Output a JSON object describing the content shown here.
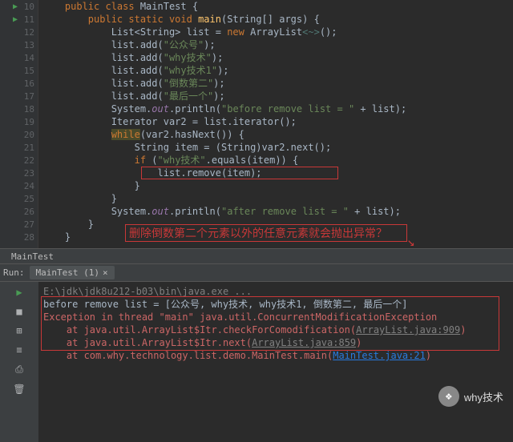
{
  "lines": [
    {
      "n": 10,
      "run": true,
      "code": [
        {
          "c": "kw",
          "t": "    public class "
        },
        {
          "c": "cls",
          "t": "MainTest {"
        }
      ]
    },
    {
      "n": 11,
      "run": true,
      "code": [
        {
          "c": "kw",
          "t": "        public static void "
        },
        {
          "c": "mth",
          "t": "main"
        },
        {
          "c": "cls",
          "t": "(String[] args) {"
        }
      ]
    },
    {
      "n": 12,
      "code": [
        {
          "c": "cls",
          "t": "            List<String> list = "
        },
        {
          "c": "kw",
          "t": "new "
        },
        {
          "c": "cls",
          "t": "ArrayList"
        },
        {
          "c": "gen",
          "t": "<~>"
        },
        {
          "c": "cls",
          "t": "();"
        }
      ]
    },
    {
      "n": 13,
      "code": [
        {
          "c": "cls",
          "t": "            list.add("
        },
        {
          "c": "str",
          "t": "\"公众号\""
        },
        {
          "c": "cls",
          "t": ");"
        }
      ]
    },
    {
      "n": 14,
      "code": [
        {
          "c": "cls",
          "t": "            list.add("
        },
        {
          "c": "str",
          "t": "\"why技术\""
        },
        {
          "c": "cls",
          "t": ");"
        }
      ]
    },
    {
      "n": 15,
      "code": [
        {
          "c": "cls",
          "t": "            list.add("
        },
        {
          "c": "str",
          "t": "\"why技术1\""
        },
        {
          "c": "cls",
          "t": ");"
        }
      ]
    },
    {
      "n": 16,
      "code": [
        {
          "c": "cls",
          "t": "            list.add("
        },
        {
          "c": "str",
          "t": "\"倒数第二\""
        },
        {
          "c": "cls",
          "t": ");"
        }
      ]
    },
    {
      "n": 17,
      "code": [
        {
          "c": "cls",
          "t": "            list.add("
        },
        {
          "c": "str",
          "t": "\"最后一个\""
        },
        {
          "c": "cls",
          "t": ");"
        }
      ]
    },
    {
      "n": 18,
      "code": [
        {
          "c": "cls",
          "t": "            System."
        },
        {
          "c": "static-field",
          "t": "out"
        },
        {
          "c": "cls",
          "t": ".println("
        },
        {
          "c": "str",
          "t": "\"before remove list = \""
        },
        {
          "c": "cls",
          "t": " + list);"
        }
      ]
    },
    {
      "n": 19,
      "code": [
        {
          "c": "cls",
          "t": "            Iterator var2 = list.iterator();"
        }
      ]
    },
    {
      "n": 20,
      "code": [
        {
          "c": "cls",
          "t": "            "
        },
        {
          "c": "hl-while kw",
          "t": "while"
        },
        {
          "c": "cls",
          "t": "(var2.hasNext()) {"
        }
      ]
    },
    {
      "n": 21,
      "code": [
        {
          "c": "cls",
          "t": "                String item = (String)var2.next();"
        }
      ]
    },
    {
      "n": 22,
      "code": [
        {
          "c": "cls",
          "t": "                "
        },
        {
          "c": "kw",
          "t": "if "
        },
        {
          "c": "cls",
          "t": "("
        },
        {
          "c": "str",
          "t": "\"why技术\""
        },
        {
          "c": "cls",
          "t": ".equals(item)) {"
        }
      ]
    },
    {
      "n": 23,
      "code": [
        {
          "c": "cls",
          "t": "                    list.remove(item);"
        }
      ]
    },
    {
      "n": 24,
      "code": [
        {
          "c": "cls",
          "t": "                }"
        }
      ]
    },
    {
      "n": 25,
      "code": [
        {
          "c": "cls",
          "t": "            }"
        }
      ]
    },
    {
      "n": 26,
      "code": [
        {
          "c": "cls",
          "t": "            System."
        },
        {
          "c": "static-field",
          "t": "out"
        },
        {
          "c": "cls",
          "t": ".println("
        },
        {
          "c": "str",
          "t": "\"after remove list = \""
        },
        {
          "c": "cls",
          "t": " + list);"
        }
      ]
    },
    {
      "n": 27,
      "code": [
        {
          "c": "cls",
          "t": "        }"
        }
      ]
    },
    {
      "n": 28,
      "code": [
        {
          "c": "cls",
          "t": "    }"
        }
      ]
    }
  ],
  "annotation": "删除倒数第二个元素以外的任意元素就会抛出异常？",
  "editor_tab": "MainTest",
  "run": {
    "label": "Run:",
    "tab": "MainTest (1)",
    "cmd": "E:\\jdk\\jdk8u212-b03\\bin\\java.exe ...",
    "out1": "before remove list = [公众号, why技术, why技术1, 倒数第二, 最后一个]",
    "ex1": "Exception in thread \"main\" java.util.ConcurrentModificationException",
    "ex2_a": "    at java.util.ArrayList$Itr.checkForComodification(",
    "ex2_l": "ArrayList.java:909",
    "ex2_b": ")",
    "ex3_a": "    at java.util.ArrayList$Itr.next(",
    "ex3_l": "ArrayList.java:859",
    "ex3_b": ")",
    "ex4_a": "    at com.why.technology.list.demo.MainTest.main(",
    "ex4_l": "MainTest.java:21",
    "ex4_b": ")"
  },
  "watermark": "why技术"
}
